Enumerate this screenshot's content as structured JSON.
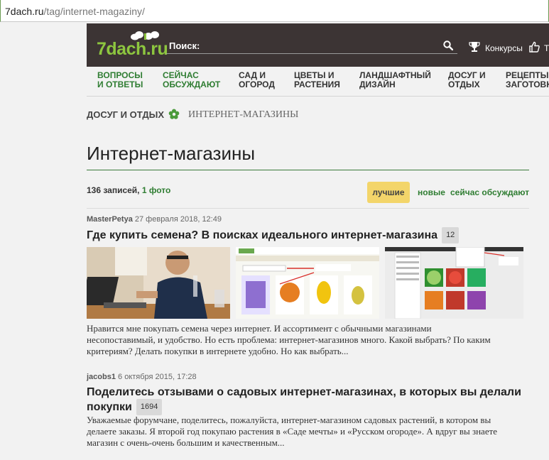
{
  "browser": {
    "url_domain": "7dach.ru",
    "url_path": "/tag/internet-magaziny/"
  },
  "header": {
    "logo_text": "7dach",
    "logo_domain": ".ru",
    "search_label": "Поиск:",
    "contests_label": "Конкурсы",
    "cut_label": "Т"
  },
  "nav": {
    "items": [
      {
        "line1": "ВОПРОСЫ",
        "line2": "И ОТВЕТЫ"
      },
      {
        "line1": "СЕЙЧАС",
        "line2": "ОБСУЖДАЮТ"
      },
      {
        "line1": "САД И",
        "line2": "ОГОРОД"
      },
      {
        "line1": "ЦВЕТЫ И",
        "line2": "РАСТЕНИЯ"
      },
      {
        "line1": "ЛАНДШАФТНЫЙ",
        "line2": "ДИЗАЙН"
      },
      {
        "line1": "ДОСУГ И",
        "line2": "ОТДЫХ"
      },
      {
        "line1": "РЕЦЕПТЫ И",
        "line2": "ЗАГОТОВКИ"
      }
    ]
  },
  "breadcrumb": {
    "parent": "ДОСУГ И ОТДЫХ",
    "current": "ИНТЕРНЕТ-МАГАЗИНЫ"
  },
  "page": {
    "title": "Интернет-магазины",
    "records": "136 записей,",
    "photos": "1 фото"
  },
  "sort": {
    "best": "лучшие",
    "new": "новые",
    "hot": "сейчас обсуждают"
  },
  "posts": [
    {
      "author": "MasterPetya",
      "date": "27 февраля 2018, 12:49",
      "title": "Где купить семена? В поисках идеального интернет-магазина",
      "count": "12",
      "excerpt_1": "Нравится мне покупать семена через интернет. И ассортимент с обычными магазинами",
      "excerpt_2": "несопоставимый, и удобство. Но есть проблема: интернет-магазинов много. Какой выбрать? По каким",
      "excerpt_3": "критериям? Делать покупки в интернете удобно. Но как выбрать..."
    },
    {
      "author": "jacobs1",
      "date": "6 октября 2015, 17:28",
      "title_1": "Поделитесь отзывами о садовых интернет-магазинах, в которых вы делали",
      "title_2": "покупки",
      "count": "1694",
      "excerpt_1": "Уважаемые форумчане, поделитесь, пожалуйста, интернет-магазином садовых растений, в котором вы",
      "excerpt_2": "делаете заказы. Я второй год покупаю растения в «Саде мечты» и «Русском огороде». А вдруг вы знаете",
      "excerpt_3": "магазин с очень-очень большим и качественным..."
    }
  ],
  "colors": {
    "header_bg": "#3c3434",
    "accent_green": "#2f7d32",
    "logo_green": "#8dc63f",
    "best_button": "#f3d56a"
  }
}
